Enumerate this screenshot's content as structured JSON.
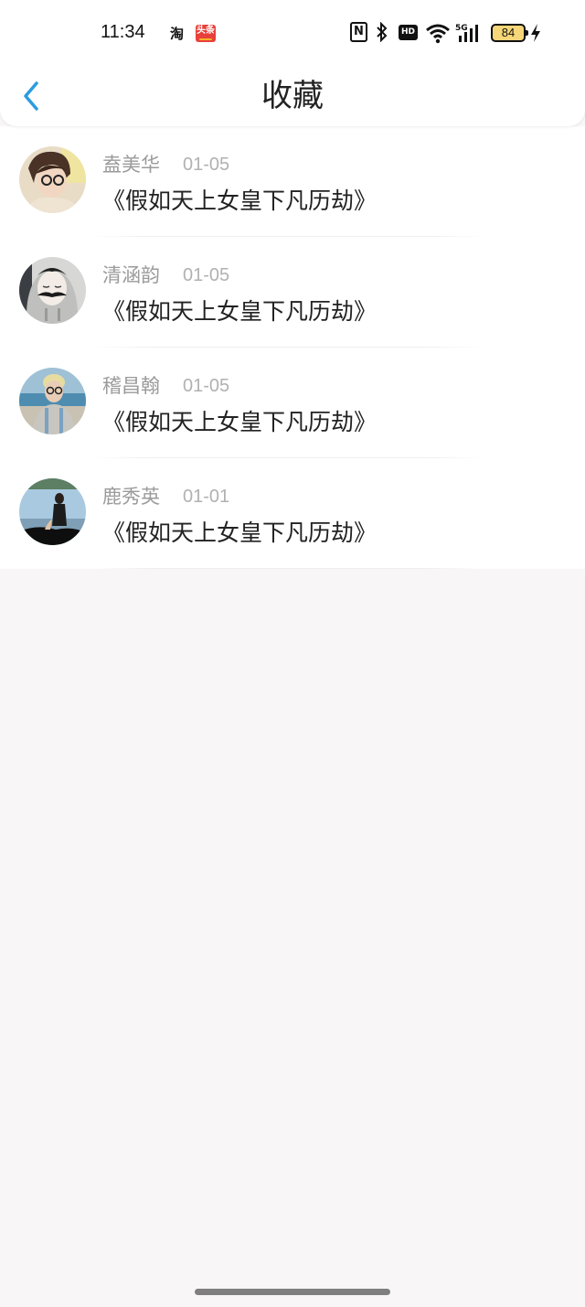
{
  "status_bar": {
    "time": "11:34",
    "app_icons": [
      "taobao-icon",
      "toutiao-icon"
    ],
    "taobao_label": "淘",
    "toutiao_label": "头条",
    "battery": "84",
    "hd_label": "HD",
    "nfc_label": "N"
  },
  "header": {
    "title": "收藏",
    "back_icon": "chevron-left-icon",
    "back_color": "#2d9be0"
  },
  "favorites": [
    {
      "name": "盍美华",
      "date": "01-05",
      "title": "《假如天上女皇下凡历劫》"
    },
    {
      "name": "清涵韵",
      "date": "01-05",
      "title": "《假如天上女皇下凡历劫》"
    },
    {
      "name": "稽昌翰",
      "date": "01-05",
      "title": "《假如天上女皇下凡历劫》"
    },
    {
      "name": "鹿秀英",
      "date": "01-01",
      "title": "《假如天上女皇下凡历劫》"
    }
  ]
}
